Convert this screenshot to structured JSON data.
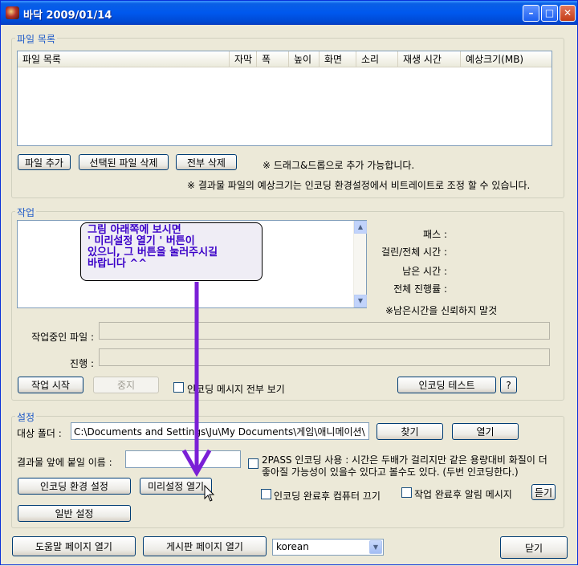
{
  "window": {
    "title": "바닥 2009/01/14"
  },
  "file_list": {
    "group_label": "파일 목록",
    "columns": [
      "파일 목록",
      "자막",
      "폭",
      "높이",
      "화면",
      "소리",
      "재생 시간",
      "예상크기(MB)"
    ],
    "add_button": "파일 추가",
    "delete_selected_button": "선택된 파일 삭제",
    "delete_all_button": "전부 삭제",
    "drag_note": "※ 드래그&드롭으로 추가 가능합니다.",
    "size_note": "※ 결과물 파일의 예상크기는 인코딩 환경설정에서 비트레이트로 조정 할 수 있습니다."
  },
  "work": {
    "group_label": "작업",
    "callout_lines": [
      "그림 아래쪽에 보시면",
      "' 미리설정 열기 ' 버튼이",
      "있으니, 그 버튼을 눌러주시길",
      "바랍니다 ^^"
    ],
    "path_label": "패스 :",
    "elapsed_label": "걸린/전체 시간 :",
    "remaining_label": "남은 시간 :",
    "progress_label": "전체 진행률 :",
    "remaining_note": "※남은시간을 신뢰하지 말것",
    "current_file_label": "작업중인 파일 :",
    "status_label": "진행 :",
    "start_button": "작업 시작",
    "stop_button": "중지",
    "show_all_messages_label": "인코딩 메시지 전부 보기",
    "encoding_test_button": "인코딩 테스트",
    "help_button": "?"
  },
  "settings": {
    "group_label": "설정",
    "target_folder_label": "대상 폴더 :",
    "target_folder_value": "C:\\Documents and Settings\\Ju\\My Documents\\게임\\애니메이션\\",
    "browse_button": "찾기",
    "open_button": "열기",
    "prefix_label": "결과물 앞에 붙일 이름 :",
    "prefix_value": "",
    "twopass_text_1": "2PASS 인코딩 사용 : 시간은 두배가 걸리지만 같은 용량대비 화질이 더",
    "twopass_text_2": "좋아질 가능성이 있을수 있다고 볼수도 있다. (두번 인코딩한다.)",
    "encoding_settings_button": "인코딩 환경 설정",
    "preset_open_button": "미리설정 열기",
    "general_settings_button": "일반 설정",
    "shutdown_label": "인코딩 완료후 컴퓨터 끄기",
    "notify_label": "작업 완료후 알림 메시지",
    "listen_button": "듣기"
  },
  "footer": {
    "help_page_button": "도움말 페이지 열기",
    "board_page_button": "게시판 페이지 열기",
    "language_value": "korean",
    "close_button": "닫기"
  },
  "colors": {
    "title_gradient": "#0058ee",
    "annotation_arrow": "#7a1fd6",
    "callout_text": "#3a00c8",
    "group_label_text": "#1d59c8"
  }
}
